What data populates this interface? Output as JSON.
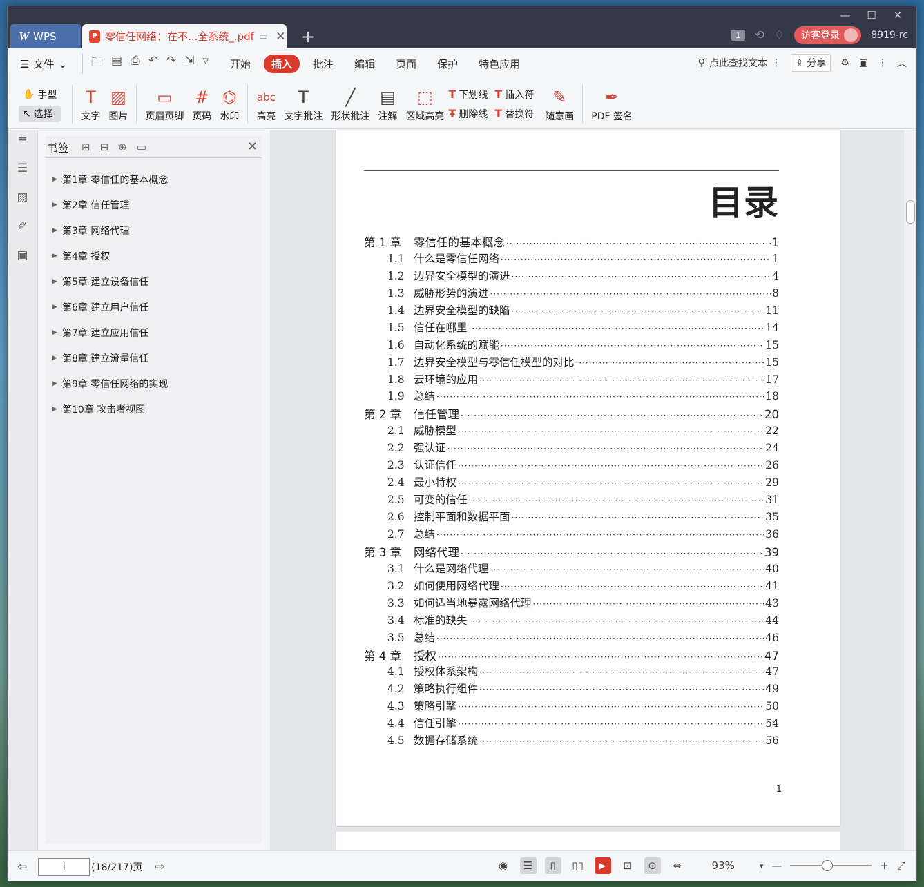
{
  "titlebar": {
    "app_tab": "WPS",
    "doc_tab": "零信任网络：在不...全系统_.pdf",
    "page_badge": "1",
    "login_label": "访客登录",
    "user_id": "8919-rc"
  },
  "menu": {
    "file_label": "文件",
    "tabs": [
      {
        "label": "开始",
        "active": false
      },
      {
        "label": "插入",
        "active": true
      },
      {
        "label": "批注",
        "active": false
      },
      {
        "label": "编辑",
        "active": false
      },
      {
        "label": "页面",
        "active": false
      },
      {
        "label": "保护",
        "active": false
      },
      {
        "label": "特色应用",
        "active": false
      }
    ],
    "search_label": "点此查找文本",
    "share_label": "分享"
  },
  "ribbon": {
    "hand_label": "手型",
    "select_label": "选择",
    "text_label": "文字",
    "image_label": "图片",
    "header_footer_label": "页眉页脚",
    "page_num_label": "页码",
    "watermark_label": "水印",
    "highlight_label": "高亮",
    "text_note_label": "文字批注",
    "shape_note_label": "形状批注",
    "comment_label": "注解",
    "area_highlight_label": "区域高亮",
    "underline_label": "下划线",
    "strikeout_label": "删除线",
    "insert_mark_label": "插入符",
    "replace_mark_label": "替换符",
    "freehand_label": "随意画",
    "pdf_sign_label": "PDF 签名"
  },
  "bookmarks": {
    "title": "书签",
    "items": [
      "第1章  零信任的基本概念",
      "第2章  信任管理",
      "第3章  网络代理",
      "第4章  授权",
      "第5章  建立设备信任",
      "第6章  建立用户信任",
      "第7章  建立应用信任",
      "第8章  建立流量信任",
      "第9章  零信任网络的实现",
      "第10章  攻击者视图"
    ]
  },
  "document": {
    "toc_title": "目录",
    "entries": [
      {
        "num": "第 1 章",
        "title": "零信任的基本概念",
        "page": "1",
        "chapter": true
      },
      {
        "num": "1.1",
        "title": "什么是零信任网络",
        "page": "1",
        "chapter": false
      },
      {
        "num": "1.2",
        "title": "边界安全模型的演进",
        "page": "4",
        "chapter": false
      },
      {
        "num": "1.3",
        "title": "威胁形势的演进",
        "page": "8",
        "chapter": false
      },
      {
        "num": "1.4",
        "title": "边界安全模型的缺陷",
        "page": "11",
        "chapter": false
      },
      {
        "num": "1.5",
        "title": "信任在哪里",
        "page": "14",
        "chapter": false
      },
      {
        "num": "1.6",
        "title": "自动化系统的赋能",
        "page": "15",
        "chapter": false
      },
      {
        "num": "1.7",
        "title": "边界安全模型与零信任模型的对比",
        "page": "15",
        "chapter": false
      },
      {
        "num": "1.8",
        "title": "云环境的应用",
        "page": "17",
        "chapter": false
      },
      {
        "num": "1.9",
        "title": "总结",
        "page": "18",
        "chapter": false
      },
      {
        "num": "第 2 章",
        "title": "信任管理",
        "page": "20",
        "chapter": true
      },
      {
        "num": "2.1",
        "title": "威胁模型",
        "page": "22",
        "chapter": false
      },
      {
        "num": "2.2",
        "title": "强认证",
        "page": "24",
        "chapter": false
      },
      {
        "num": "2.3",
        "title": "认证信任",
        "page": "26",
        "chapter": false
      },
      {
        "num": "2.4",
        "title": "最小特权",
        "page": "29",
        "chapter": false
      },
      {
        "num": "2.5",
        "title": "可变的信任",
        "page": "31",
        "chapter": false
      },
      {
        "num": "2.6",
        "title": "控制平面和数据平面",
        "page": "35",
        "chapter": false
      },
      {
        "num": "2.7",
        "title": "总结",
        "page": "36",
        "chapter": false
      },
      {
        "num": "第 3 章",
        "title": "网络代理",
        "page": "39",
        "chapter": true
      },
      {
        "num": "3.1",
        "title": "什么是网络代理",
        "page": "40",
        "chapter": false
      },
      {
        "num": "3.2",
        "title": "如何使用网络代理",
        "page": "41",
        "chapter": false
      },
      {
        "num": "3.3",
        "title": "如何适当地暴露网络代理",
        "page": "43",
        "chapter": false
      },
      {
        "num": "3.4",
        "title": "标准的缺失",
        "page": "44",
        "chapter": false
      },
      {
        "num": "3.5",
        "title": "总结",
        "page": "46",
        "chapter": false
      },
      {
        "num": "第 4 章",
        "title": "授权",
        "page": "47",
        "chapter": true
      },
      {
        "num": "4.1",
        "title": "授权体系架构",
        "page": "47",
        "chapter": false
      },
      {
        "num": "4.2",
        "title": "策略执行组件",
        "page": "49",
        "chapter": false
      },
      {
        "num": "4.3",
        "title": "策略引擎",
        "page": "50",
        "chapter": false
      },
      {
        "num": "4.4",
        "title": "信任引擎",
        "page": "54",
        "chapter": false
      },
      {
        "num": "4.5",
        "title": "数据存储系统",
        "page": "56",
        "chapter": false
      }
    ],
    "page_footer_number": "1"
  },
  "statusbar": {
    "page_input_value": "i",
    "page_info": "(18/217)页",
    "zoom_label": "93%"
  }
}
